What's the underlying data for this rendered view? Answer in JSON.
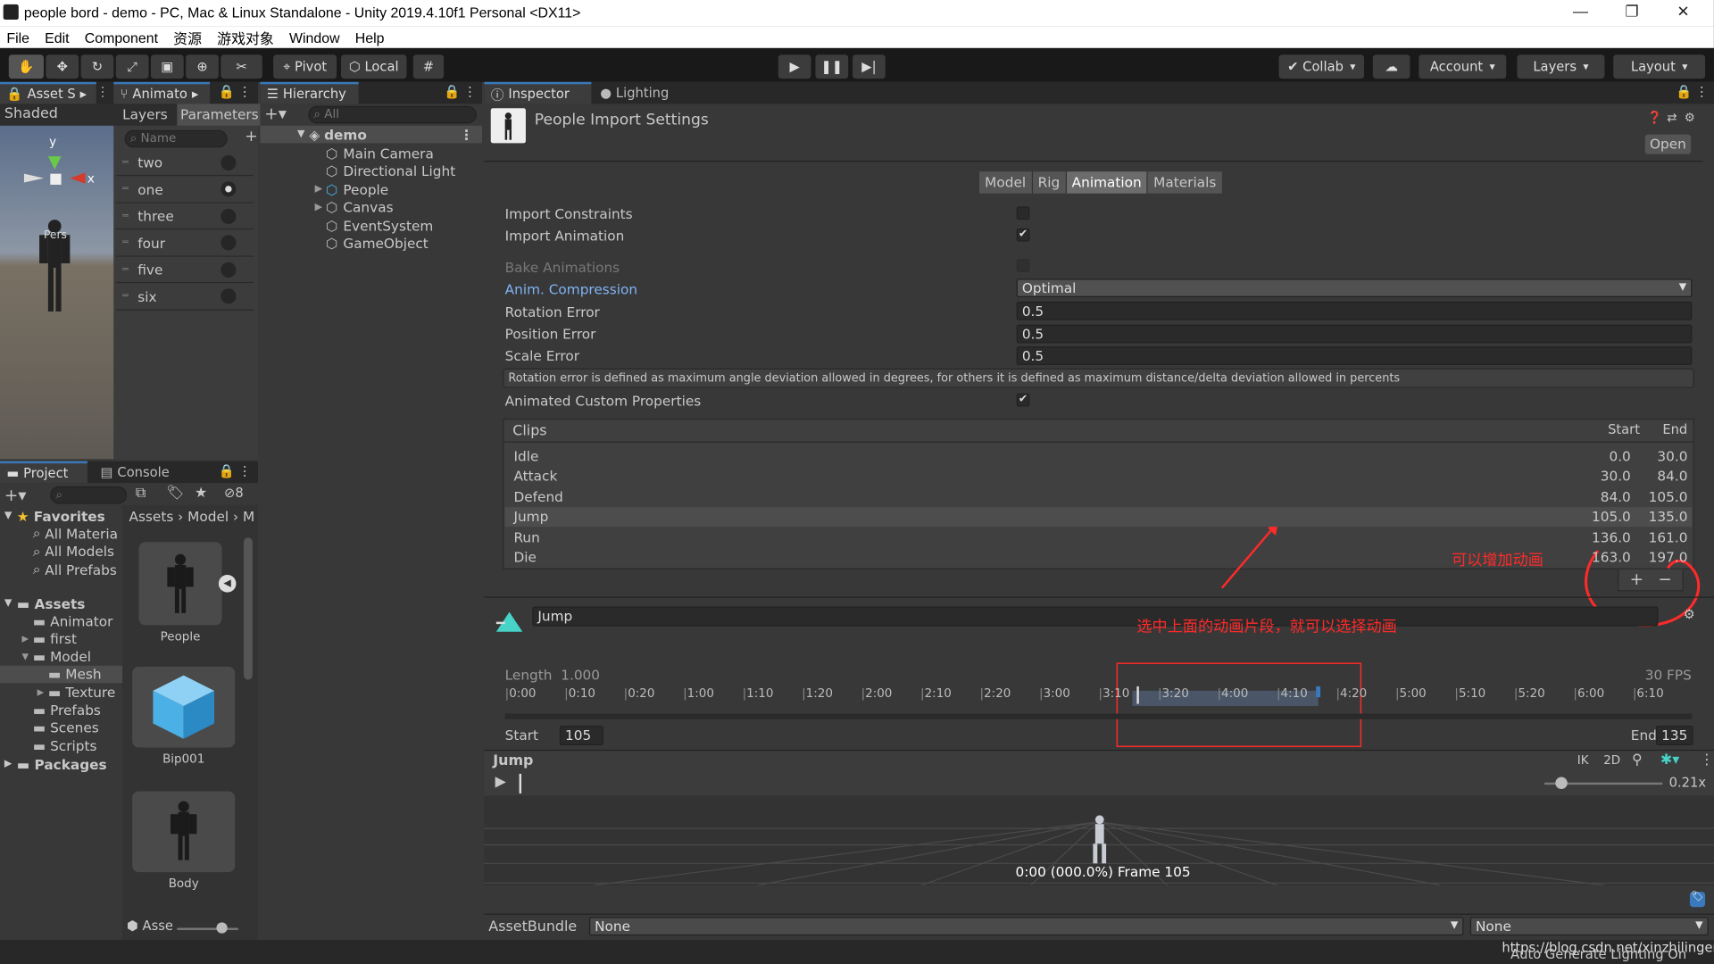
{
  "window": {
    "title": "people bord - demo - PC, Mac & Linux Standalone - Unity 2019.4.10f1 Personal <DX11>"
  },
  "menu": [
    "File",
    "Edit",
    "Component",
    "资源",
    "游戏对象",
    "Window",
    "Help"
  ],
  "toolbar": {
    "pivot": "Pivot",
    "local": "Local",
    "collab": "Collab",
    "account": "Account",
    "layers": "Layers",
    "layout": "Layout"
  },
  "scene": {
    "tab": "Asset S",
    "shading": "Shaded",
    "person_label": "Pers"
  },
  "animator": {
    "tab": "Animato",
    "layers_tab": "Layers",
    "params_tab": "Parameters",
    "name_placeholder": "Name",
    "params": [
      {
        "label": "two",
        "on": false
      },
      {
        "label": "one",
        "on": true
      },
      {
        "label": "three",
        "on": false
      },
      {
        "label": "four",
        "on": false
      },
      {
        "label": "five",
        "on": false
      },
      {
        "label": "six",
        "on": false
      }
    ]
  },
  "hierarchy": {
    "tab": "Hierarchy",
    "search_placeholder": "All",
    "root": "demo",
    "items": [
      {
        "label": "Main Camera",
        "expand": false
      },
      {
        "label": "Directional Light",
        "expand": false
      },
      {
        "label": "People",
        "expand": true
      },
      {
        "label": "Canvas",
        "expand": true
      },
      {
        "label": "EventSystem",
        "expand": false
      },
      {
        "label": "GameObject",
        "expand": false
      }
    ]
  },
  "project": {
    "tab": "Project",
    "console_tab": "Console",
    "hidden_count": "8",
    "favorites": "Favorites",
    "fav_items": [
      "All Materia",
      "All Models",
      "All Prefabs"
    ],
    "assets": "Assets",
    "tree": [
      {
        "label": "Animator",
        "level": 1
      },
      {
        "label": "first",
        "level": 1
      },
      {
        "label": "Model",
        "level": 1
      },
      {
        "label": "Mesh",
        "level": 2
      },
      {
        "label": "Texture",
        "level": 2
      },
      {
        "label": "Prefabs",
        "level": 1
      },
      {
        "label": "Scenes",
        "level": 1
      },
      {
        "label": "Scripts",
        "level": 1
      }
    ],
    "packages": "Packages",
    "breadcrumb": [
      "Assets",
      "Model",
      "M"
    ],
    "grid_items": [
      "People",
      "Bip001",
      "Body"
    ],
    "bottom_label": "Asse"
  },
  "inspector": {
    "tab": "Inspector",
    "lighting_tab": "Lighting",
    "title": "People Import Settings",
    "open_btn": "Open",
    "subtabs": [
      "Model",
      "Rig",
      "Animation",
      "Materials"
    ],
    "active_subtab": "Animation",
    "import_constraints": "Import Constraints",
    "import_animation": "Import Animation",
    "bake_animations": "Bake Animations",
    "anim_compression_label": "Anim. Compression",
    "anim_compression_value": "Optimal",
    "rotation_error_label": "Rotation Error",
    "rotation_error": "0.5",
    "position_error_label": "Position Error",
    "position_error": "0.5",
    "scale_error_label": "Scale Error",
    "scale_error": "0.5",
    "help_text": "Rotation error is defined as maximum angle deviation allowed in degrees, for others it is defined as maximum distance/delta deviation allowed in percents",
    "animated_custom_props": "Animated Custom Properties",
    "clips_header": "Clips",
    "start_header": "Start",
    "end_header": "End",
    "clips": [
      {
        "name": "Idle",
        "start": "0.0",
        "end": "30.0"
      },
      {
        "name": "Attack",
        "start": "30.0",
        "end": "84.0"
      },
      {
        "name": "Defend",
        "start": "84.0",
        "end": "105.0"
      },
      {
        "name": "Jump",
        "start": "105.0",
        "end": "135.0"
      },
      {
        "name": "Run",
        "start": "136.0",
        "end": "161.0"
      },
      {
        "name": "Die",
        "start": "163.0",
        "end": "197.0"
      }
    ],
    "selected_clip": "Jump",
    "annotation_add": "可以增加动画",
    "annotation_select": "选中上面的动画片段，就可以选择动画",
    "clip_name": "Jump",
    "length_label": "Length",
    "length_value": "1.000",
    "fps": "30 FPS",
    "ticks": [
      "0:00",
      "0:10",
      "0:20",
      "1:00",
      "1:10",
      "1:20",
      "2:00",
      "2:10",
      "2:20",
      "3:00",
      "3:10",
      "3:20",
      "4:00",
      "4:10",
      "4:20",
      "5:00",
      "5:10",
      "5:20",
      "6:00",
      "6:10"
    ],
    "start_label": "Start",
    "start_value": "105",
    "end_label": "End",
    "end_value": "135",
    "preview_title": "Jump",
    "ik": "IK",
    "two_d": "2D",
    "speed": "0.21x",
    "frame_text": "0:00 (000.0%) Frame 105",
    "assetbundle_label": "AssetBundle",
    "assetbundle_value": "None",
    "assetbundle_variant": "None"
  },
  "status": {
    "watermark": "https://blog.csdn.net/xinzhilinger",
    "text": "Auto Generate Lighting On"
  },
  "colors": {
    "accent": "#3a79bb",
    "annotation": "#ff2a2a",
    "link": "#7fb3f5"
  }
}
